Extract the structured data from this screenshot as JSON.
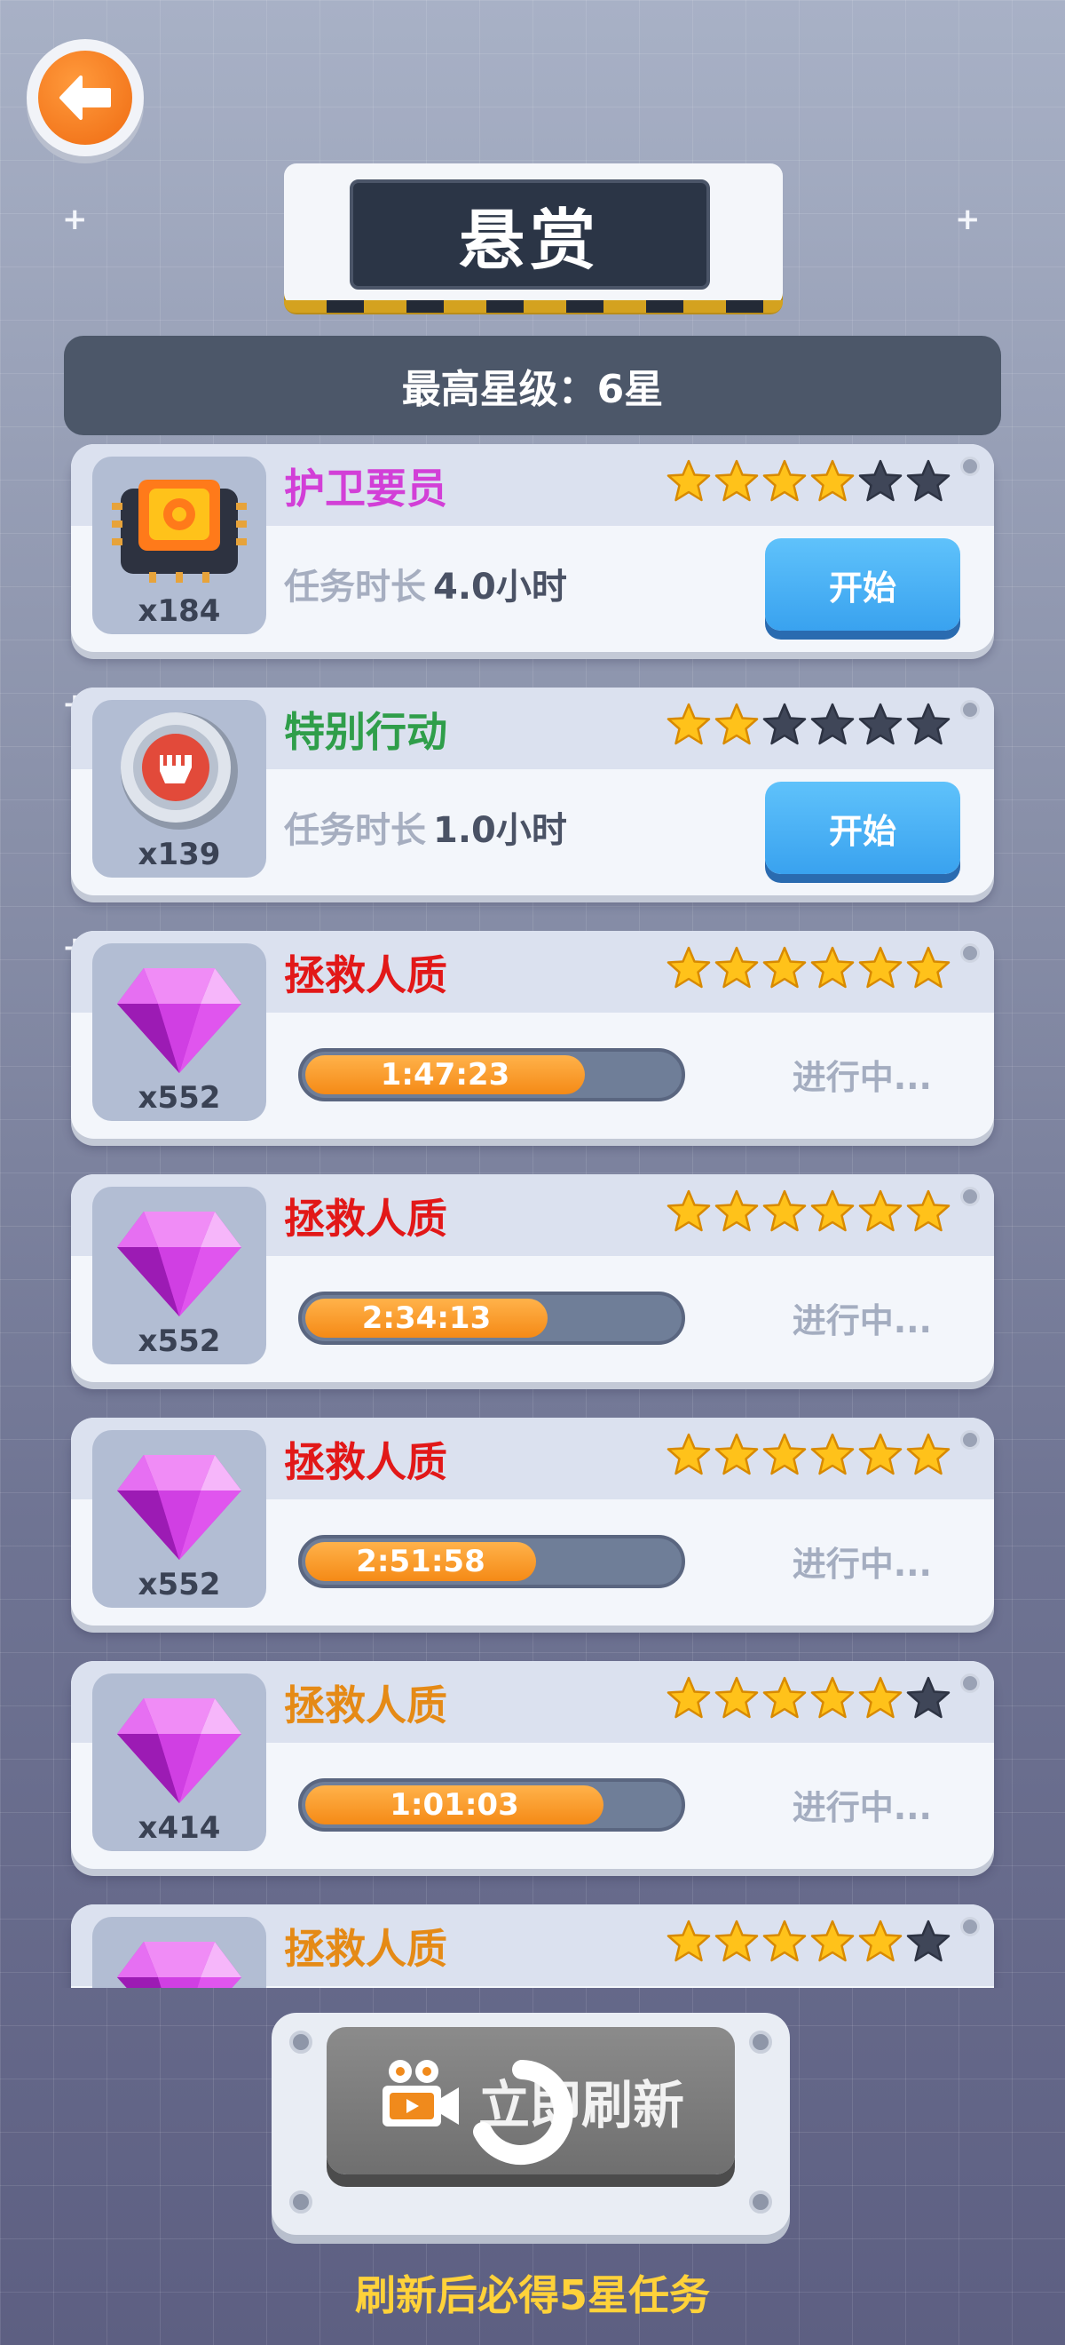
{
  "header": {
    "title": "悬赏",
    "max_star_label": "最高星级：6星"
  },
  "colors": {
    "name_magenta": "#d23fd7",
    "name_green": "#2f9e4a",
    "name_red": "#e21818",
    "name_orange": "#e58a16",
    "star_gold": "#ffc21a",
    "star_empty": "#3f4658"
  },
  "missions": [
    {
      "name": "护卫要员",
      "name_color": "#d23fd7",
      "stars": 4,
      "max_stars": 6,
      "reward_icon": "chip-icon",
      "reward_count": "x184",
      "state": "idle",
      "duration_label": "任务时长",
      "duration_value": "4.0小时",
      "button_label": "开始"
    },
    {
      "name": "特别行动",
      "name_color": "#2f9e4a",
      "stars": 2,
      "max_stars": 6,
      "reward_icon": "fist-coin-icon",
      "reward_count": "x139",
      "state": "idle",
      "duration_label": "任务时长",
      "duration_value": "1.0小时",
      "button_label": "开始"
    },
    {
      "name": "拯救人质",
      "name_color": "#e21818",
      "stars": 6,
      "max_stars": 6,
      "reward_icon": "gem-icon",
      "reward_count": "x552",
      "state": "running",
      "timer": "1:47:23",
      "progress": 0.75,
      "status": "进行中..."
    },
    {
      "name": "拯救人质",
      "name_color": "#e21818",
      "stars": 6,
      "max_stars": 6,
      "reward_icon": "gem-icon",
      "reward_count": "x552",
      "state": "running",
      "timer": "2:34:13",
      "progress": 0.65,
      "status": "进行中..."
    },
    {
      "name": "拯救人质",
      "name_color": "#e21818",
      "stars": 6,
      "max_stars": 6,
      "reward_icon": "gem-icon",
      "reward_count": "x552",
      "state": "running",
      "timer": "2:51:58",
      "progress": 0.62,
      "status": "进行中..."
    },
    {
      "name": "拯救人质",
      "name_color": "#e58a16",
      "stars": 5,
      "max_stars": 6,
      "reward_icon": "gem-icon",
      "reward_count": "x414",
      "state": "running",
      "timer": "1:01:03",
      "progress": 0.8,
      "status": "进行中..."
    },
    {
      "name": "拯救人质",
      "name_color": "#e58a16",
      "stars": 5,
      "max_stars": 6,
      "reward_icon": "gem-icon",
      "reward_count": "",
      "state": "partial"
    }
  ],
  "refresh": {
    "button_label": "立即刷新",
    "icon": "video-camera-icon",
    "hint": "刷新后必得5星任务"
  }
}
